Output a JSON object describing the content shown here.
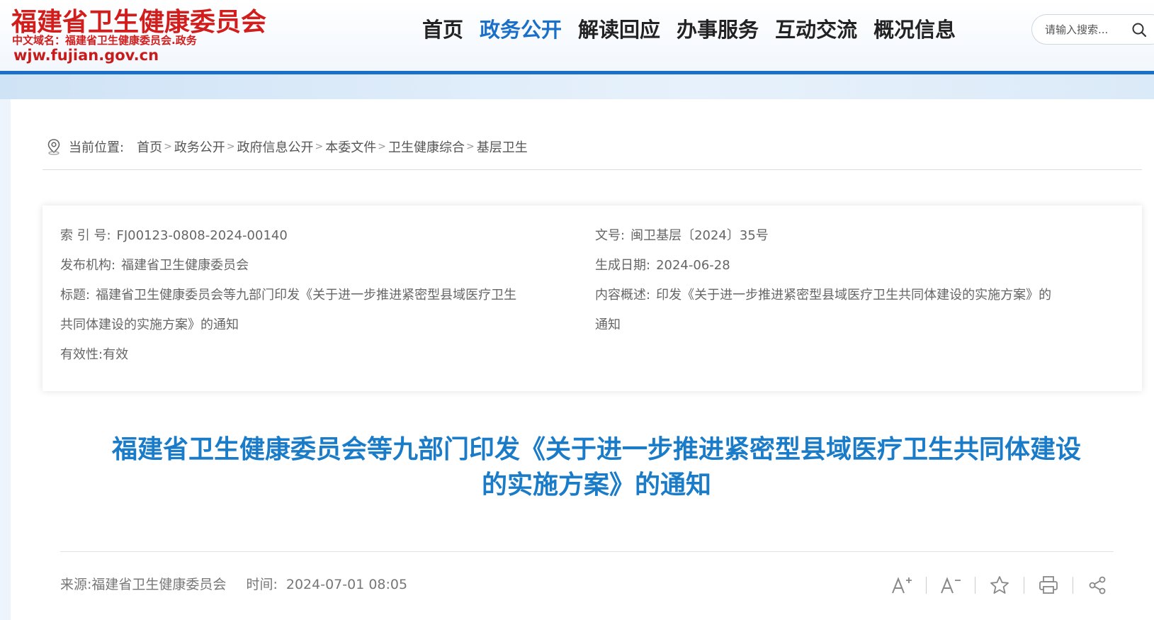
{
  "header": {
    "site_title": "福建省卫生健康委员会",
    "cn_domain": "中文域名：福建省卫生健康委员会.政务",
    "domain": "wjw.fujian.gov.cn"
  },
  "nav": {
    "items": [
      {
        "label": "首页",
        "active": false
      },
      {
        "label": "政务公开",
        "active": true
      },
      {
        "label": "解读回应",
        "active": false
      },
      {
        "label": "办事服务",
        "active": false
      },
      {
        "label": "互动交流",
        "active": false
      },
      {
        "label": "概况信息",
        "active": false
      }
    ]
  },
  "search": {
    "placeholder": "请输入搜索..."
  },
  "breadcrumb": {
    "label": "当前位置:",
    "items": [
      "首页",
      "政务公开",
      "政府信息公开",
      "本委文件",
      "卫生健康综合",
      "基层卫生"
    ]
  },
  "meta": {
    "index_no_key": "索 引 号:",
    "index_no": "FJ00123-0808-2024-00140",
    "doc_no_key": "文号:",
    "doc_no": "闽卫基层〔2024〕35号",
    "publisher_key": "发布机构:",
    "publisher": "福建省卫生健康委员会",
    "date_key": "生成日期:",
    "date": "2024-06-28",
    "title_key": "标题:",
    "title_line1": "福建省卫生健康委员会等九部门印发《关于进一步推进紧密型县域医疗卫生",
    "title_line2": "共同体建设的实施方案》的通知",
    "summary_key": "内容概述:",
    "summary_line1": "印发《关于进一步推进紧密型县域医疗卫生共同体建设的实施方案》的",
    "summary_line2": "通知",
    "validity_key": "有效性:",
    "validity": "有效"
  },
  "article": {
    "title_line1": "福建省卫生健康委员会等九部门印发《关于进一步推进紧密型县域医疗卫生共同体建设",
    "title_line2": "的实施方案》的通知",
    "source": "来源:福建省卫生健康委员会",
    "time_key": "时间:",
    "time": "2024-07-01 08:05"
  },
  "tools": [
    "font-increase-icon",
    "font-decrease-icon",
    "favorite-star-icon",
    "print-icon",
    "share-icon"
  ],
  "colors": {
    "brand_red": "#d21d1d",
    "accent_blue": "#1a6fc8",
    "title_blue": "#1a7cc8"
  }
}
